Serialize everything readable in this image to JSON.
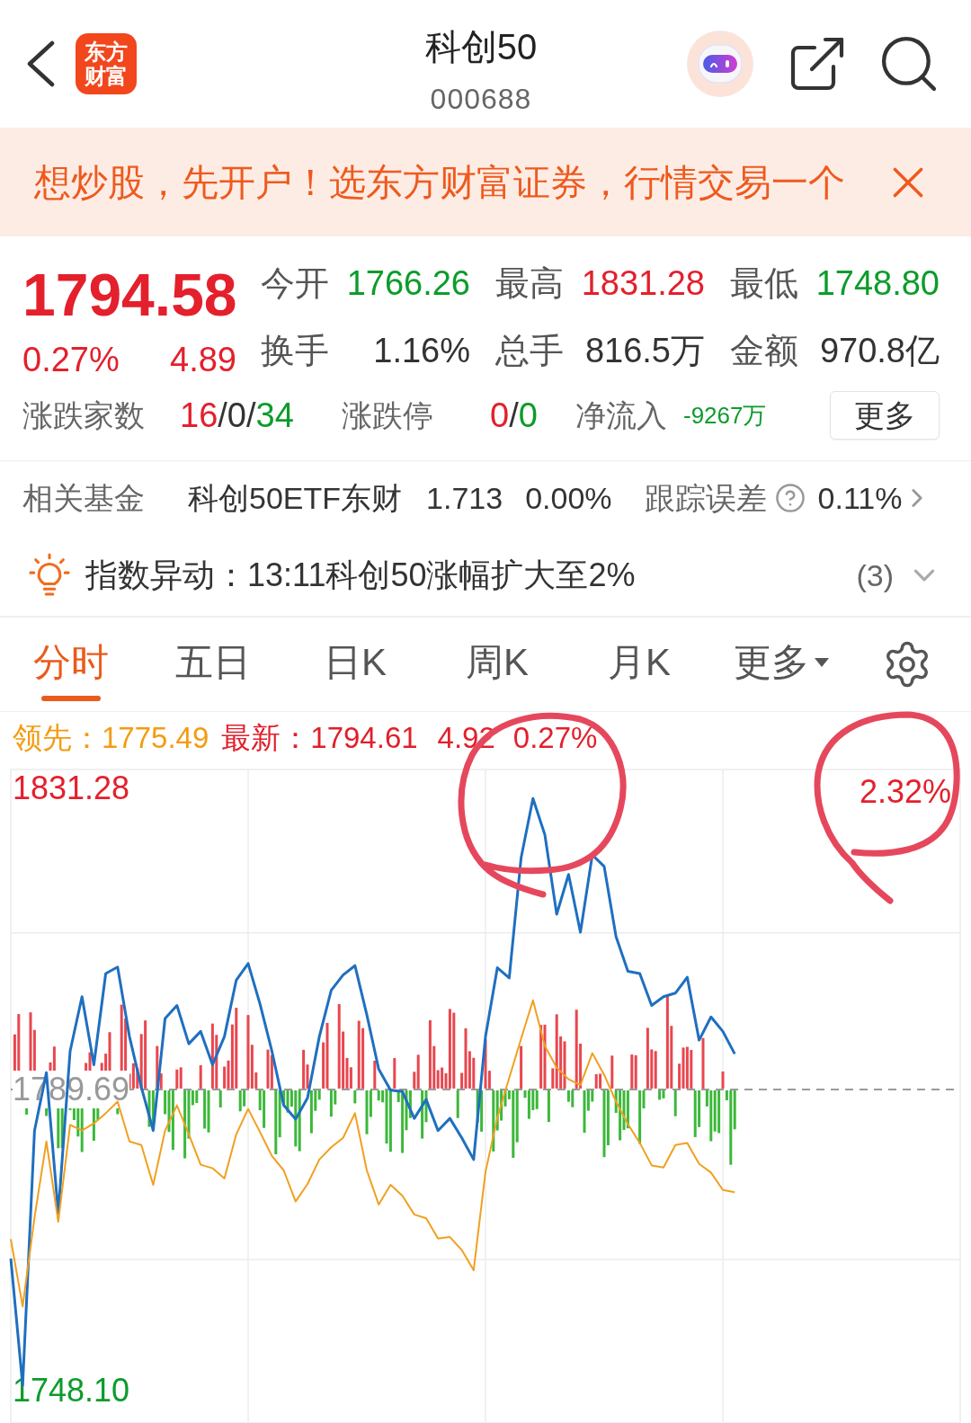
{
  "header": {
    "logo_text": "东方财富",
    "title": "科创50",
    "code": "000688"
  },
  "banner": {
    "text": "想炒股，先开户！选东方财富证券，行情交易一个"
  },
  "quote": {
    "price": "1794.58",
    "change_pct": "0.27%",
    "change": "4.89",
    "color": "#e3202c",
    "stats": [
      {
        "label": "今开",
        "value": "1766.26",
        "color": "#0c9c2b"
      },
      {
        "label": "最高",
        "value": "1831.28",
        "color": "#e3202c"
      },
      {
        "label": "最低",
        "value": "1748.80",
        "color": "#0c9c2b"
      },
      {
        "label": "换手",
        "value": "1.16%",
        "color": "#333333"
      },
      {
        "label": "总手",
        "value": "816.5万",
        "color": "#333333"
      },
      {
        "label": "金额",
        "value": "970.8亿",
        "color": "#333333"
      }
    ],
    "breadth": [
      {
        "label": "涨跌家数",
        "parts": [
          {
            "text": "16",
            "color": "#e3202c"
          },
          {
            "text": "/",
            "color": "#333333"
          },
          {
            "text": "0",
            "color": "#333333"
          },
          {
            "text": "/",
            "color": "#333333"
          },
          {
            "text": "34",
            "color": "#0c9c2b"
          }
        ]
      },
      {
        "label": "涨跌停",
        "parts": [
          {
            "text": "0",
            "color": "#e3202c"
          },
          {
            "text": "/",
            "color": "#333333"
          },
          {
            "text": "0",
            "color": "#0c9c2b"
          }
        ]
      }
    ],
    "net_inflow": {
      "label": "净流入",
      "value": "-9267万",
      "color": "#0c9c2b"
    },
    "more_button": "更多"
  },
  "related_fund": {
    "label": "相关基金",
    "name": "科创50ETF东财",
    "price": "1.713",
    "change_pct": "0.00%",
    "tracking_error_label": "跟踪误差",
    "tracking_error": "0.11%"
  },
  "alert": {
    "text": "指数异动：13:11科创50涨幅扩大至2%",
    "count": "(3)"
  },
  "tabs": [
    {
      "label": "分时",
      "selected": true,
      "kind": "tab"
    },
    {
      "label": "五日",
      "selected": false,
      "kind": "tab"
    },
    {
      "label": "日K",
      "selected": false,
      "kind": "tab"
    },
    {
      "label": "周K",
      "selected": false,
      "kind": "tab"
    },
    {
      "label": "月K",
      "selected": false,
      "kind": "tab"
    },
    {
      "label": "更多",
      "selected": false,
      "kind": "dropdown"
    }
  ],
  "chart": {
    "legend": [
      {
        "label": "领先：",
        "value": "1775.49",
        "color": "#f39c12"
      },
      {
        "label": "最新：",
        "value": "1794.61",
        "color": "#e0202b"
      }
    ],
    "change": "4.92",
    "change_pct": "0.27%",
    "color": "#e3202c",
    "right_axis_label": "2.32%",
    "chart_data": {
      "type": "line",
      "grid": true,
      "ylim": [
        1743.6,
        1833.9
      ],
      "yticks": [
        {
          "value": 1831.28,
          "label": "1831.28"
        },
        {
          "value": 1789.69,
          "label": "1789.69"
        },
        {
          "value": 1748.1,
          "label": "1748.10"
        }
      ],
      "categories": [
        null,
        null,
        null,
        null,
        null,
        null,
        null,
        null,
        null,
        null,
        null,
        null,
        null,
        null,
        null,
        null,
        null,
        null,
        null,
        null,
        null,
        null,
        null,
        null,
        null,
        null,
        null,
        null,
        null,
        null,
        null,
        null,
        null,
        null,
        null,
        null,
        null,
        null,
        null,
        null,
        null,
        null,
        null,
        null,
        null,
        null,
        null,
        null,
        null,
        null,
        null,
        null,
        null,
        null,
        null,
        null,
        null,
        null,
        null,
        null,
        null,
        null,
        null,
        null,
        null,
        null,
        null,
        null,
        null,
        null,
        null,
        null,
        null,
        null,
        null,
        null,
        null,
        null,
        null,
        null,
        null
      ],
      "series": [
        {
          "color": "#1f6fc0",
          "values": [
            1766.3,
            1748.8,
            1784.0,
            1792.0,
            1772.6,
            1795.0,
            1802.5,
            1793.1,
            1805.7,
            1806.6,
            1797.0,
            1790.0,
            1784.0,
            1799.5,
            1801.3,
            1796.0,
            1797.7,
            1793.1,
            1797.0,
            1804.8,
            1807.1,
            1801.5,
            1795.0,
            1787.5,
            1785.6,
            1788.5,
            1797.0,
            1803.4,
            1805.5,
            1806.8,
            1800.0,
            1792.5,
            1789.6,
            1789.4,
            1785.7,
            1788.3,
            1784.0,
            1785.7,
            1783.0,
            1780.0,
            1797.0,
            1806.5,
            1805.1,
            1821.7,
            1829.9,
            1824.9,
            1813.9,
            1819.4,
            1811.4,
            1822.1,
            1820.5,
            1810.8,
            1806.0,
            1805.7,
            1801.3,
            1802.5,
            1803.0,
            1805.2,
            1796.5,
            1799.7,
            1797.7,
            1794.6,
            null,
            null,
            null,
            null,
            null,
            null,
            null,
            null,
            null,
            null,
            null,
            null,
            null,
            null,
            null,
            null,
            null,
            null,
            null
          ]
        },
        {
          "color": "#f0a020",
          "values": [
            1769.0,
            1759.7,
            1772.0,
            1782.5,
            1771.4,
            1784.8,
            1784.0,
            1785.0,
            1786.4,
            1788.0,
            1782.5,
            1782.0,
            1776.5,
            1784.0,
            1787.5,
            1783.5,
            1779.3,
            1778.8,
            1777.4,
            1783.5,
            1787.0,
            1783.8,
            1780.5,
            1778.5,
            1774.2,
            1776.6,
            1780.0,
            1781.7,
            1783.0,
            1786.4,
            1778.5,
            1773.8,
            1776.5,
            1775.0,
            1772.4,
            1771.9,
            1769.1,
            1769.3,
            1767.5,
            1764.7,
            1778.3,
            1785.8,
            1791.3,
            1796.7,
            1802.0,
            1795.7,
            1792.7,
            1791.1,
            1790.3,
            1794.7,
            1791.7,
            1788.0,
            1784.9,
            1782.3,
            1779.2,
            1778.9,
            1782.0,
            1782.3,
            1779.4,
            1778.2,
            1775.8,
            1775.5,
            null,
            null,
            null,
            null,
            null,
            null,
            null,
            null,
            null,
            null,
            null,
            null,
            null,
            null,
            null,
            null,
            null,
            null,
            null
          ]
        }
      ]
    }
  }
}
